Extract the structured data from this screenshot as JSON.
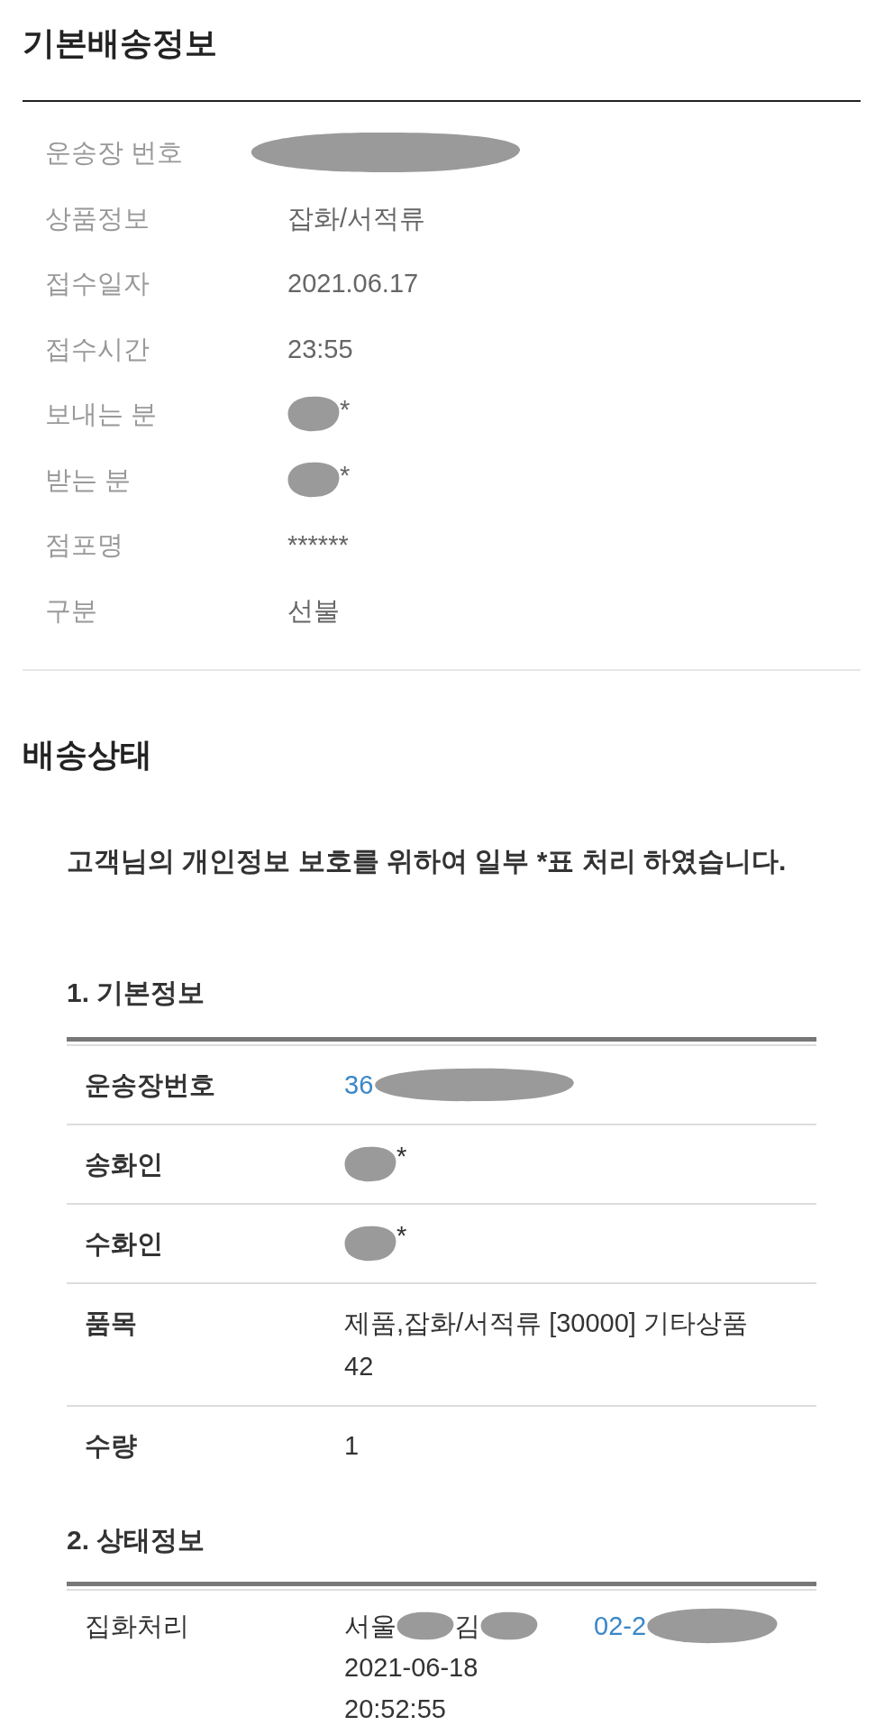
{
  "basic_delivery_info": {
    "title": "기본배송정보",
    "fields": [
      {
        "label": "운송장 번호",
        "value": [
          {
            "kind": "redaction"
          }
        ]
      },
      {
        "label": "상품정보",
        "value": [
          {
            "kind": "text",
            "text": "잡화/서적류"
          }
        ]
      },
      {
        "label": "접수일자",
        "value": [
          {
            "kind": "text",
            "text": "2021.06.17"
          }
        ]
      },
      {
        "label": "접수시간",
        "value": [
          {
            "kind": "text",
            "text": "23:55"
          }
        ]
      },
      {
        "label": "보내는 분",
        "value": [
          {
            "kind": "redaction"
          },
          {
            "kind": "text",
            "text": "*"
          }
        ]
      },
      {
        "label": "받는 분",
        "value": [
          {
            "kind": "redaction"
          },
          {
            "kind": "text",
            "text": "*"
          }
        ]
      },
      {
        "label": "점포명",
        "value": [
          {
            "kind": "text",
            "text": "******"
          }
        ]
      },
      {
        "label": "구분",
        "value": [
          {
            "kind": "text",
            "text": "선불"
          }
        ]
      }
    ]
  },
  "delivery_status": {
    "title": "배송상태",
    "notice": "고객님의 개인정보 보호를 위하여 일부 *표 처리 하였습니다.",
    "basic_info": {
      "title": "1. 기본정보",
      "rows": [
        {
          "label": "운송장번호",
          "value": [
            {
              "kind": "link",
              "text": "36"
            },
            {
              "kind": "redaction"
            }
          ]
        },
        {
          "label": "송화인",
          "value": [
            {
              "kind": "redaction"
            },
            {
              "kind": "text",
              "text": "*"
            }
          ]
        },
        {
          "label": "수화인",
          "value": [
            {
              "kind": "redaction"
            },
            {
              "kind": "text",
              "text": "*"
            }
          ]
        },
        {
          "label": "품목",
          "value": [
            {
              "kind": "text",
              "text": "제품,잡화/서적류 [30000] 기타상품 42"
            }
          ]
        },
        {
          "label": "수량",
          "value": [
            {
              "kind": "text",
              "text": "1"
            }
          ]
        }
      ]
    },
    "status_info": {
      "title": "2. 상태정보",
      "events": [
        {
          "status": "집화처리",
          "place": [
            {
              "kind": "text",
              "text": "서울"
            },
            {
              "kind": "redaction"
            },
            {
              "kind": "text",
              "text": "김"
            },
            {
              "kind": "redaction"
            }
          ],
          "date": "2021-06-18",
          "time": "20:52:55",
          "phone": [
            {
              "kind": "link",
              "text": "02-2"
            },
            {
              "kind": "redaction"
            }
          ]
        }
      ]
    }
  }
}
